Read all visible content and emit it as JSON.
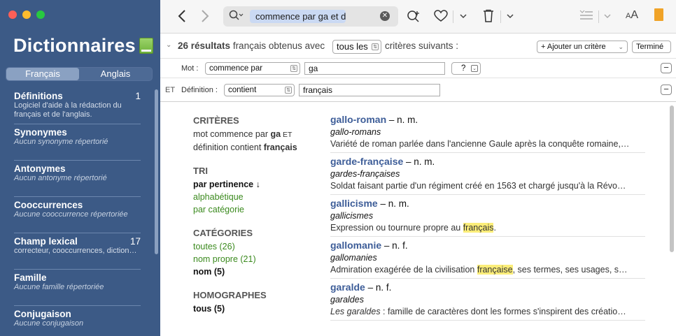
{
  "app": {
    "title": "Dictionnaires"
  },
  "sidebar": {
    "tabs": [
      "Français",
      "Anglais"
    ],
    "active_tab": "Français",
    "sections": [
      {
        "title": "Définitions",
        "count": "1",
        "subtitle": "Logiciel d'aide à la rédaction du français et de l'anglais.",
        "italic": false
      },
      {
        "title": "Synonymes",
        "count": "",
        "subtitle": "Aucun synonyme répertorié",
        "italic": true
      },
      {
        "title": "Antonymes",
        "count": "",
        "subtitle": "Aucun antonyme répertorié",
        "italic": true
      },
      {
        "title": "Cooccurrences",
        "count": "",
        "subtitle": "Aucune cooccurrence répertoriée",
        "italic": true
      },
      {
        "title": "Champ lexical",
        "count": "17",
        "subtitle": "correcteur, cooccurrences, dictionnaire, orthographique, tex…",
        "italic": false
      },
      {
        "title": "Famille",
        "count": "",
        "subtitle": "Aucune famille répertoriée",
        "italic": true
      },
      {
        "title": "Conjugaison",
        "count": "",
        "subtitle": "Aucune conjugaison",
        "italic": true
      }
    ]
  },
  "toolbar": {
    "back_icon": "chevron-left",
    "forward_icon": "chevron-right",
    "search_token": "commence par ga et dé…",
    "zoom_in_icon": "magnifier-plus",
    "favorite_icon": "heart",
    "trash_icon": "trash",
    "list_icon": "list-lines",
    "text_size_label": "AA"
  },
  "criteria": {
    "results_count": "26 résultats",
    "results_text": "français obtenus avec",
    "mode": "tous les",
    "criteria_text": "critères suivants :",
    "add_button": "+ Ajouter un critère",
    "done_button": "Terminé",
    "row1": {
      "label": "Mot :",
      "operator": "commence par",
      "value": "ga",
      "wildcard": "?"
    },
    "row2": {
      "conjunction": "ET",
      "label": "Définition :",
      "operator": "contient",
      "value": "français"
    }
  },
  "filters": {
    "criteria_title": "CRITÈRES",
    "criteria_line1_pre": "mot commence par ",
    "criteria_line1_bold": "ga",
    "criteria_line1_post": " ET",
    "criteria_line2_pre": "définition contient ",
    "criteria_line2_bold": "français",
    "sort_title": "TRI",
    "sort_items": [
      "par pertinence ↓",
      "alphabétique",
      "par catégorie"
    ],
    "categories_title": "CATÉGORIES",
    "categories_items": [
      "toutes (26)",
      "nom propre (21)",
      "nom (5)"
    ],
    "homographs_title": "HOMOGRAPHES",
    "homographs_items": [
      "tous (5)"
    ]
  },
  "results": [
    {
      "word": "gallo-roman",
      "pos": " – n. m.",
      "variant": "gallo-romans",
      "def_pre": "Variété de roman parlée dans l'ancienne Gaule après la conquête romaine,…",
      "def_hl": "",
      "def_post": "",
      "def_italic_pre": ""
    },
    {
      "word": "garde-française",
      "pos": " – n. m.",
      "variant": "gardes-françaises",
      "def_pre": "Soldat faisant partie d'un régiment créé en 1563 et chargé jusqu'à la Révo…",
      "def_hl": "",
      "def_post": "",
      "def_italic_pre": ""
    },
    {
      "word": "gallicisme",
      "pos": " – n. m.",
      "variant": "gallicismes",
      "def_pre": "Expression ou tournure propre au ",
      "def_hl": "français",
      "def_post": ".",
      "def_italic_pre": ""
    },
    {
      "word": "gallomanie",
      "pos": " – n. f.",
      "variant": "gallomanies",
      "def_pre": "Admiration exagérée de la civilisation ",
      "def_hl": "française",
      "def_post": ", ses termes, ses usages, s…",
      "def_italic_pre": ""
    },
    {
      "word": "garalde",
      "pos": " – n. f.",
      "variant": "garaldes",
      "def_pre": " : famille de caractères dont les formes s'inspirent des créatio…",
      "def_hl": "",
      "def_post": "",
      "def_italic_pre": "Les garaldes"
    }
  ],
  "colors": {
    "sidebar_bg": "#3c5a86",
    "link_green": "#3b8a1e",
    "word_blue": "#3d5d98",
    "highlight": "#fbed79"
  }
}
